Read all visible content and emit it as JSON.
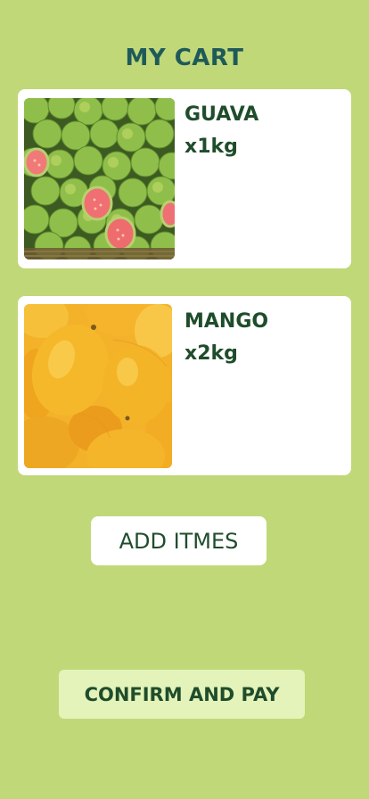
{
  "header": {
    "title": "MY CART"
  },
  "cart": {
    "items": [
      {
        "name": "GUAVA",
        "quantity": "x1kg",
        "image": "guava-photo"
      },
      {
        "name": "MANGO",
        "quantity": "x2kg",
        "image": "mango-photo"
      }
    ]
  },
  "actions": {
    "add_items_label": "ADD ITMES",
    "confirm_pay_label": "CONFIRM AND PAY"
  },
  "colors": {
    "background": "#c0d878",
    "title": "#1f5a5a",
    "text": "#1f4d2c",
    "card": "#ffffff",
    "confirm_button": "#e4f3ba"
  }
}
